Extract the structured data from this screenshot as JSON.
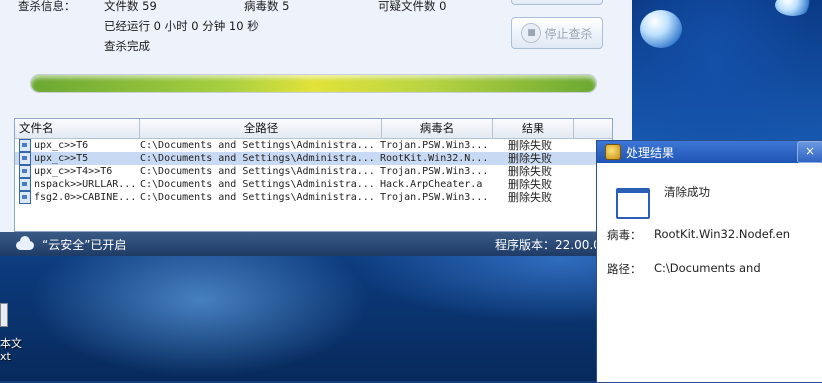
{
  "scan_info": {
    "label": "查杀信息：",
    "files_scanned": "文件数 59",
    "virus_count": "病毒数 5",
    "suspicious_count": "可疑文件数 0",
    "elapsed": "已经运行 0 小时 0 分钟 10  秒",
    "status": "查杀完成",
    "progress": 1.0
  },
  "buttons": {
    "stop_label": "停止查杀"
  },
  "table": {
    "headers": [
      "文件名",
      "全路径",
      "病毒名",
      "结果"
    ],
    "rows": [
      {
        "name": "upx_c>>T6",
        "path": "C:\\Documents and Settings\\Administra...",
        "virus": "Trojan.PSW.Win3...",
        "result": "删除失败",
        "selected": false
      },
      {
        "name": "upx_c>>T5",
        "path": "C:\\Documents and Settings\\Administra...",
        "virus": "RootKit.Win32.N...",
        "result": "删除失败",
        "selected": true
      },
      {
        "name": "upx_c>>T4>>T6",
        "path": "C:\\Documents and Settings\\Administra...",
        "virus": "Trojan.PSW.Win3...",
        "result": "删除失败",
        "selected": false
      },
      {
        "name": "nspack>>URLLAR...",
        "path": "C:\\Documents and Settings\\Administra...",
        "virus": "Hack.ArpCheater.a",
        "result": "删除失败",
        "selected": false
      },
      {
        "name": "fsg2.0>>CABINE...",
        "path": "C:\\Documents and Settings\\Administra...",
        "virus": "Trojan.PSW.Win3...",
        "result": "删除失败",
        "selected": false
      }
    ]
  },
  "status_bar": {
    "cloud_text": "“云安全”已开启",
    "version": "程序版本：22.00.0"
  },
  "dialog": {
    "title": "处理结果",
    "close": "×",
    "message": "清除成功",
    "virus_label": "病毒：",
    "virus_value": "RootKit.Win32.Nodef.en",
    "path_label": "路径：",
    "path_value": "C:\\Documents and"
  },
  "desktop": {
    "icon_label_1": "本文",
    "icon_label_2": "xt"
  }
}
